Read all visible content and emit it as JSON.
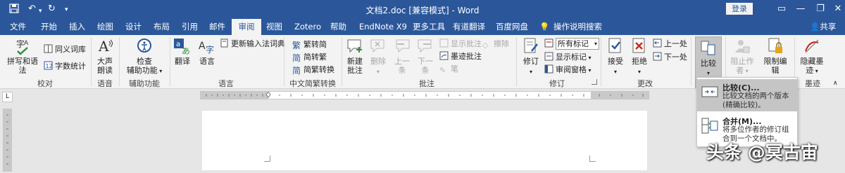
{
  "titlebar": {
    "doc_title": "文档2.doc [兼容模式] - Word",
    "login": "登录",
    "save_icon": "save-icon",
    "undo_icon": "undo-icon",
    "redo_icon": "redo-icon"
  },
  "tabs": [
    "文件",
    "开始",
    "插入",
    "绘图",
    "设计",
    "布局",
    "引用",
    "邮件",
    "审阅",
    "视图",
    "Zotero",
    "帮助",
    "EndNote X9",
    "更多工具",
    "有道翻译",
    "百度网盘",
    "操作说明搜索"
  ],
  "active_tab": "审阅",
  "share": "共享",
  "ribbon": {
    "proofing": {
      "spell": "拼写和语法",
      "thesaurus": "同义词库",
      "wordcount": "字数统计",
      "label": "校对"
    },
    "speech": {
      "read": "大声\n朗读",
      "read_l1": "大声",
      "read_l2": "朗读",
      "label": "语音"
    },
    "access": {
      "check_l1": "检查",
      "check_l2": "辅助功能",
      "label": "辅助功能"
    },
    "language": {
      "translate": "翻译",
      "language": "语言",
      "ime": "更新输入法词典",
      "label": "语言"
    },
    "chinese": {
      "tc": "繁转简",
      "sc": "简转繁",
      "conv": "简繁转换",
      "label": "中文简繁转换"
    },
    "comments": {
      "new_l1": "新建",
      "new_l2": "批注",
      "delete": "删除",
      "prev": "上一条",
      "next": "下一条",
      "show": "显示批注",
      "ink": "墨迹批注",
      "pen": "笔",
      "erase": "擦除",
      "label": "批注"
    },
    "tracking": {
      "track": "修订",
      "markup_select": "所有标记",
      "show_markup": "显示标记",
      "pane": "审阅窗格",
      "label": "修订"
    },
    "changes": {
      "accept": "接受",
      "reject": "拒绝",
      "prev": "上一处",
      "next": "下一处",
      "label": "更改"
    },
    "compare": {
      "compare": "比较",
      "label": "比较"
    },
    "protect": {
      "block": "阻止作者",
      "restrict": "限制编辑",
      "label": "保护"
    },
    "ink": {
      "hide_l1": "隐藏墨",
      "hide_l2": "迹",
      "label": "墨迹"
    }
  },
  "dropdown": {
    "compare_title": "比较(C)...",
    "compare_desc": "比较文档的两个版本(精确比较)。",
    "combine_title": "合并(M)...",
    "combine_desc": "将多位作者的修订组合到一个文档中。"
  },
  "ruler_corner": "L",
  "watermark": "头条 @冥古宙",
  "colors": {
    "accent": "#2b579a",
    "ribbon": "#f3f3f3",
    "workspace": "#e6e6e6"
  }
}
